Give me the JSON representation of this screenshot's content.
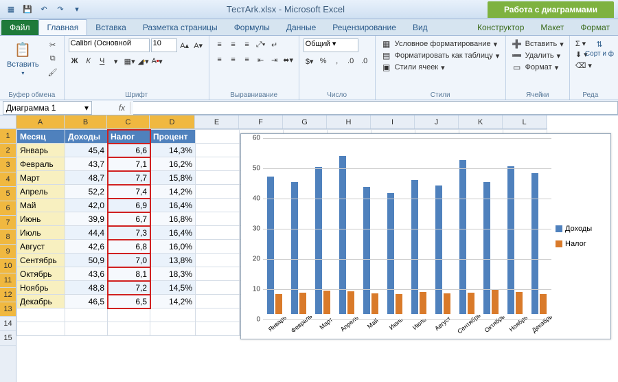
{
  "titlebar": {
    "filename": "ТестArk.xlsx",
    "app": "Microsoft Excel",
    "chart_tools": "Работа с диаграммами"
  },
  "tabs": {
    "file": "Файл",
    "home": "Главная",
    "insert": "Вставка",
    "page_layout": "Разметка страницы",
    "formulas": "Формулы",
    "data": "Данные",
    "review": "Рецензирование",
    "view": "Вид",
    "chart_design": "Конструктор",
    "chart_layout": "Макет",
    "chart_format": "Формат"
  },
  "ribbon": {
    "clipboard": {
      "paste": "Вставить",
      "label": "Буфер обмена"
    },
    "font": {
      "name": "Calibri (Основной",
      "size": "10",
      "label": "Шрифт",
      "bold": "Ж",
      "italic": "К",
      "underline": "Ч"
    },
    "alignment": {
      "label": "Выравнивание"
    },
    "number": {
      "format": "Общий",
      "label": "Число"
    },
    "styles": {
      "cond_fmt": "Условное форматирование",
      "as_table": "Форматировать как таблицу",
      "cell_styles": "Стили ячеек",
      "label": "Стили"
    },
    "cells": {
      "insert": "Вставить",
      "delete": "Удалить",
      "format": "Формат",
      "label": "Ячейки"
    },
    "editing": {
      "sort": "Сорт и ф",
      "label": "Реда"
    }
  },
  "name_box": "Диаграмма 1",
  "columns": [
    "A",
    "B",
    "C",
    "D",
    "E",
    "F",
    "G",
    "H",
    "I",
    "J",
    "K",
    "L"
  ],
  "table": {
    "headers": {
      "month": "Месяц",
      "income": "Доходы",
      "tax": "Налог",
      "percent": "Процент"
    },
    "rows": [
      {
        "m": "Январь",
        "inc": "45,4",
        "tax": "6,6",
        "pct": "14,3%"
      },
      {
        "m": "Февраль",
        "inc": "43,7",
        "tax": "7,1",
        "pct": "16,2%"
      },
      {
        "m": "Март",
        "inc": "48,7",
        "tax": "7,7",
        "pct": "15,8%"
      },
      {
        "m": "Апрель",
        "inc": "52,2",
        "tax": "7,4",
        "pct": "14,2%"
      },
      {
        "m": "Май",
        "inc": "42,0",
        "tax": "6,9",
        "pct": "16,4%"
      },
      {
        "m": "Июнь",
        "inc": "39,9",
        "tax": "6,7",
        "pct": "16,8%"
      },
      {
        "m": "Июль",
        "inc": "44,4",
        "tax": "7,3",
        "pct": "16,4%"
      },
      {
        "m": "Август",
        "inc": "42,6",
        "tax": "6,8",
        "pct": "16,0%"
      },
      {
        "m": "Сентябрь",
        "inc": "50,9",
        "tax": "7,0",
        "pct": "13,8%"
      },
      {
        "m": "Октябрь",
        "inc": "43,6",
        "tax": "8,1",
        "pct": "18,3%"
      },
      {
        "m": "Ноябрь",
        "inc": "48,8",
        "tax": "7,2",
        "pct": "14,5%"
      },
      {
        "m": "Декабрь",
        "inc": "46,5",
        "tax": "6,5",
        "pct": "14,2%"
      }
    ]
  },
  "chart_legend": {
    "s1": "Доходы",
    "s2": "Налог"
  },
  "chart_data": {
    "type": "bar",
    "categories": [
      "Январь",
      "Февраль",
      "Март",
      "Апрель",
      "Май",
      "Июнь",
      "Июль",
      "Август",
      "Сентябрь",
      "Октябрь",
      "Ноябрь",
      "Декабрь"
    ],
    "series": [
      {
        "name": "Доходы",
        "values": [
          45.4,
          43.7,
          48.7,
          52.2,
          42.0,
          39.9,
          44.4,
          42.6,
          50.9,
          43.6,
          48.8,
          46.5
        ],
        "color": "#4f81bd"
      },
      {
        "name": "Налог",
        "values": [
          6.6,
          7.1,
          7.7,
          7.4,
          6.9,
          6.7,
          7.3,
          6.8,
          7.0,
          8.1,
          7.2,
          6.5
        ],
        "color": "#d97a2a"
      }
    ],
    "ylim": [
      0,
      60
    ],
    "yticks": [
      0,
      10,
      20,
      30,
      40,
      50,
      60
    ],
    "xlabel": "",
    "ylabel": "",
    "title": ""
  }
}
